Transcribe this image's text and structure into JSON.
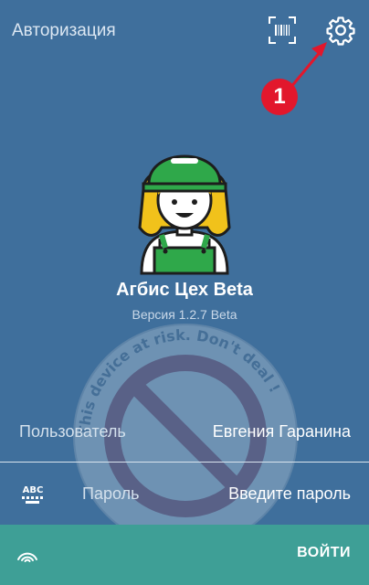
{
  "header": {
    "title": "Авторизация",
    "barcode_icon": "barcode-scan-icon",
    "settings_icon": "gear-icon"
  },
  "annotation": {
    "label": "1",
    "color": "#e2172c"
  },
  "app": {
    "name": "Агбис Цех Beta",
    "version": "Версия 1.2.7 Beta",
    "avatar_icon": "worker-avatar-icon"
  },
  "watermark": {
    "text": "This device at risk. Don't deal !",
    "icon": "prohibited-sign-icon"
  },
  "form": {
    "user_label": "Пользователь",
    "user_value": "Евгения Гаранина",
    "password_icon": "keyboard-abc-icon",
    "password_label": "Пароль",
    "password_value": "Введите пароль"
  },
  "footer": {
    "fingerprint_icon": "fingerprint-icon",
    "login_label": "ВОЙТИ"
  },
  "colors": {
    "background": "#3f6f9c",
    "footer": "#3e9f96",
    "cap_green": "#2fa84a",
    "hair_yellow": "#f1c21b"
  }
}
